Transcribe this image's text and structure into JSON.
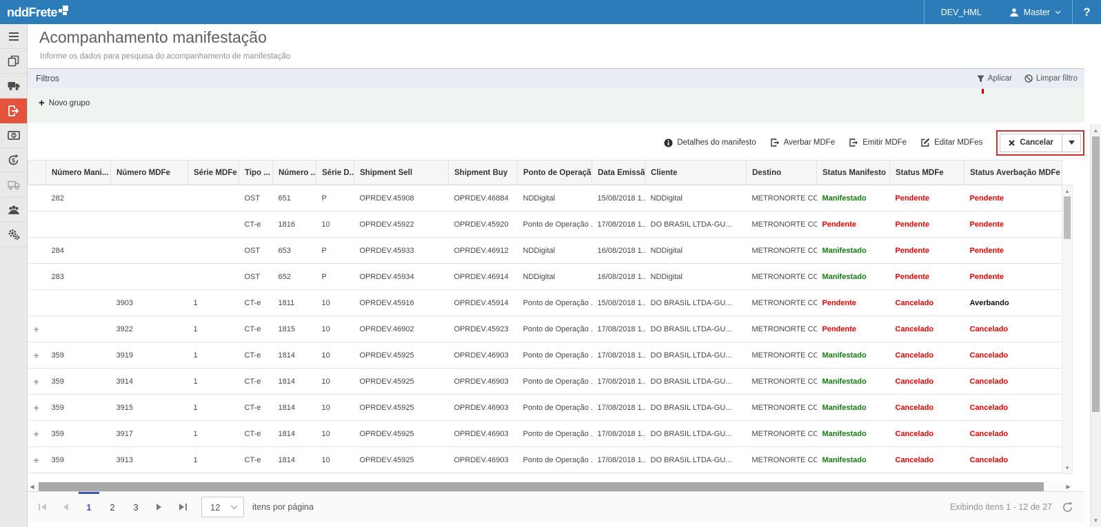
{
  "topbar": {
    "logo": "nddFrete",
    "environment": "DEV_HML",
    "user": "Master",
    "help": "?"
  },
  "sidebar": {
    "items": [
      "menu-icon",
      "documents-icon",
      "truck-icon",
      "manifest-export-icon",
      "banknote-icon",
      "currency-sync-icon",
      "delivery-truck-icon",
      "users-icon",
      "gears-icon"
    ],
    "active_item": "manifest-export-icon"
  },
  "page": {
    "title": "Acompanhamento manifestação",
    "subtitle": "Informe os dados para pesquisa do acompanhamento de manifestação"
  },
  "filters": {
    "title": "Filtros",
    "apply": "Aplicar",
    "clear": "Limpar filtro",
    "new_group": "Novo grupo"
  },
  "toolbar": {
    "details": "Detalhes do manifesto",
    "averbar": "Averbar MDFe",
    "emitir": "Emitir MDFe",
    "editar": "Editar MDFes",
    "cancelar": "Cancelar"
  },
  "table": {
    "columns": [
      "",
      "Número Mani...",
      "Número MDFe",
      "Série MDFe",
      "Tipo ...",
      "Número ...",
      "Série D...",
      "Shipment Sell",
      "Shipment Buy",
      "Ponto de Operação",
      "Data Emissã...",
      "Cliente",
      "Destino",
      "Status Manifesto",
      "Status MDFe",
      "Status Averbação MDFe"
    ],
    "sorted_column": "Status Averbação MDFe",
    "sort_direction": "asc",
    "rows": [
      {
        "expand": false,
        "cells": [
          "282",
          "",
          "",
          "OST",
          "651",
          "P",
          "OPRDEV.45908",
          "OPRDEV.46884",
          "NDDigital",
          "15/08/2018 1...",
          "NDDigital",
          "METRONORTE CO..."
        ],
        "statuses": [
          {
            "text": "Manifestado",
            "tone": "green"
          },
          {
            "text": "Pendente",
            "tone": "red"
          },
          {
            "text": "Pendente",
            "tone": "red"
          }
        ]
      },
      {
        "expand": false,
        "cells": [
          "",
          "",
          "",
          "CT-e",
          "1816",
          "10",
          "OPRDEV.45922",
          "OPRDEV.45920",
          "Ponto de Operação ...",
          "17/08/2018 1...",
          "DO BRASIL LTDA-GU...",
          "METRONORTE CO..."
        ],
        "statuses": [
          {
            "text": "Pendente",
            "tone": "red"
          },
          {
            "text": "Pendente",
            "tone": "red"
          },
          {
            "text": "Pendente",
            "tone": "red"
          }
        ]
      },
      {
        "expand": false,
        "cells": [
          "284",
          "",
          "",
          "OST",
          "653",
          "P",
          "OPRDEV.45933",
          "OPRDEV.46912",
          "NDDigital",
          "16/08/2018 1...",
          "NDDigital",
          "METRONORTE CO..."
        ],
        "statuses": [
          {
            "text": "Manifestado",
            "tone": "green"
          },
          {
            "text": "Pendente",
            "tone": "red"
          },
          {
            "text": "Pendente",
            "tone": "red"
          }
        ]
      },
      {
        "expand": false,
        "cells": [
          "283",
          "",
          "",
          "OST",
          "652",
          "P",
          "OPRDEV.45934",
          "OPRDEV.46914",
          "NDDigital",
          "16/08/2018 1...",
          "NDDigital",
          "METRONORTE CO..."
        ],
        "statuses": [
          {
            "text": "Manifestado",
            "tone": "green"
          },
          {
            "text": "Pendente",
            "tone": "red"
          },
          {
            "text": "Pendente",
            "tone": "red"
          }
        ]
      },
      {
        "expand": false,
        "cells": [
          "",
          "3903",
          "1",
          "CT-e",
          "1811",
          "10",
          "OPRDEV.45916",
          "OPRDEV.45914",
          "Ponto de Operação ...",
          "15/08/2018 1...",
          "DO BRASIL LTDA-GU...",
          "METRONORTE CO..."
        ],
        "statuses": [
          {
            "text": "Pendente",
            "tone": "red"
          },
          {
            "text": "Cancelado",
            "tone": "red"
          },
          {
            "text": "Averbando",
            "tone": "black"
          }
        ]
      },
      {
        "expand": true,
        "cells": [
          "",
          "3922",
          "1",
          "CT-e",
          "1815",
          "10",
          "OPRDEV.46902",
          "OPRDEV.45923",
          "Ponto de Operação ...",
          "17/08/2018 1...",
          "DO BRASIL LTDA-GU...",
          "METRONORTE CO..."
        ],
        "statuses": [
          {
            "text": "Pendente",
            "tone": "red"
          },
          {
            "text": "Cancelado",
            "tone": "red"
          },
          {
            "text": "Cancelado",
            "tone": "red"
          }
        ]
      },
      {
        "expand": true,
        "cells": [
          "359",
          "3919",
          "1",
          "CT-e",
          "1814",
          "10",
          "OPRDEV.45925",
          "OPRDEV.46903",
          "Ponto de Operação ...",
          "17/08/2018 1...",
          "DO BRASIL LTDA-GU...",
          "METRONORTE CO..."
        ],
        "statuses": [
          {
            "text": "Manifestado",
            "tone": "green"
          },
          {
            "text": "Cancelado",
            "tone": "red"
          },
          {
            "text": "Cancelado",
            "tone": "red"
          }
        ]
      },
      {
        "expand": true,
        "cells": [
          "359",
          "3914",
          "1",
          "CT-e",
          "1814",
          "10",
          "OPRDEV.45925",
          "OPRDEV.46903",
          "Ponto de Operação ...",
          "17/08/2018 1...",
          "DO BRASIL LTDA-GU...",
          "METRONORTE CO..."
        ],
        "statuses": [
          {
            "text": "Manifestado",
            "tone": "green"
          },
          {
            "text": "Cancelado",
            "tone": "red"
          },
          {
            "text": "Cancelado",
            "tone": "red"
          }
        ]
      },
      {
        "expand": true,
        "cells": [
          "359",
          "3915",
          "1",
          "CT-e",
          "1814",
          "10",
          "OPRDEV.45925",
          "OPRDEV.46903",
          "Ponto de Operação ...",
          "17/08/2018 1...",
          "DO BRASIL LTDA-GU...",
          "METRONORTE CO..."
        ],
        "statuses": [
          {
            "text": "Manifestado",
            "tone": "green"
          },
          {
            "text": "Cancelado",
            "tone": "red"
          },
          {
            "text": "Cancelado",
            "tone": "red"
          }
        ]
      },
      {
        "expand": true,
        "cells": [
          "359",
          "3917",
          "1",
          "CT-e",
          "1814",
          "10",
          "OPRDEV.45925",
          "OPRDEV.46903",
          "Ponto de Operação ...",
          "17/08/2018 1...",
          "DO BRASIL LTDA-GU...",
          "METRONORTE CO..."
        ],
        "statuses": [
          {
            "text": "Manifestado",
            "tone": "green"
          },
          {
            "text": "Cancelado",
            "tone": "red"
          },
          {
            "text": "Cancelado",
            "tone": "red"
          }
        ]
      },
      {
        "expand": true,
        "cells": [
          "359",
          "3913",
          "1",
          "CT-e",
          "1814",
          "10",
          "OPRDEV.45925",
          "OPRDEV.46903",
          "Ponto de Operação ...",
          "17/08/2018 1...",
          "DO BRASIL LTDA-GU...",
          "METRONORTE CO..."
        ],
        "statuses": [
          {
            "text": "Manifestado",
            "tone": "green"
          },
          {
            "text": "Cancelado",
            "tone": "red"
          },
          {
            "text": "Cancelado",
            "tone": "red"
          }
        ]
      }
    ]
  },
  "pagination": {
    "pages": [
      "1",
      "2",
      "3"
    ],
    "active_page": "1",
    "page_size": "12",
    "page_size_label": "itens por página",
    "summary": "Exibindo itens 1 - 12 de 27"
  },
  "colors": {
    "topbar_blue": "#2b7cb9",
    "active_nav_red": "#e2553c",
    "status_green": "#117d11",
    "status_red": "#e60000",
    "annotation_red": "#cb2f2f",
    "active_page_blue": "#3e55b9"
  }
}
